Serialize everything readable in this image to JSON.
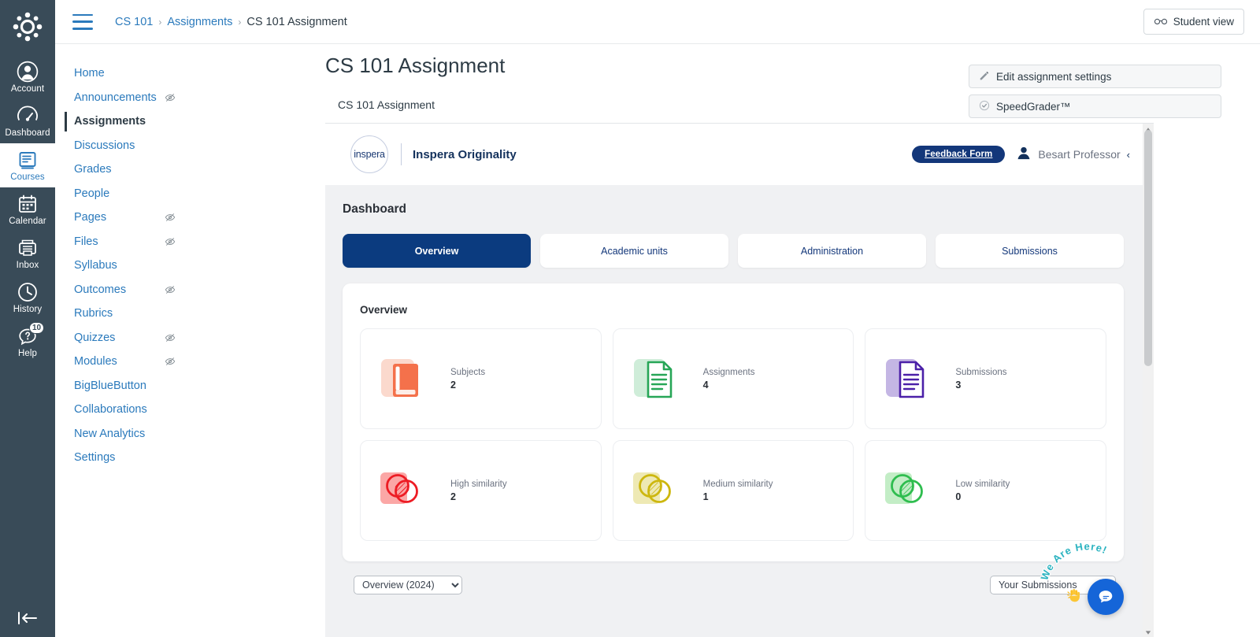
{
  "global_nav": {
    "logo_icon": "canvas-logo-icon",
    "items": [
      {
        "label": "Account",
        "icon": "account-avatar-icon",
        "active": false,
        "badge": ""
      },
      {
        "label": "Dashboard",
        "icon": "dashboard-speedometer-icon",
        "active": false,
        "badge": ""
      },
      {
        "label": "Courses",
        "icon": "courses-book-icon",
        "active": true,
        "badge": ""
      },
      {
        "label": "Calendar",
        "icon": "calendar-icon",
        "active": false,
        "badge": ""
      },
      {
        "label": "Inbox",
        "icon": "inbox-tray-icon",
        "active": false,
        "badge": ""
      },
      {
        "label": "History",
        "icon": "history-clock-icon",
        "active": false,
        "badge": ""
      },
      {
        "label": "Help",
        "icon": "help-question-bubble-icon",
        "active": false,
        "badge": "10"
      }
    ],
    "collapse_icon": "collapse-sidebar-icon"
  },
  "topbar": {
    "menu_icon": "hamburger-menu-icon",
    "breadcrumb": [
      {
        "label": "CS 101",
        "current": false
      },
      {
        "label": "Assignments",
        "current": false
      },
      {
        "label": "CS 101 Assignment",
        "current": true
      }
    ],
    "breadcrumb_separator": "›",
    "student_view_label": "Student view",
    "student_view_icon": "eyeglasses-icon"
  },
  "course_nav": {
    "items": [
      {
        "label": "Home",
        "hidden_icon": false,
        "active": false
      },
      {
        "label": "Announcements",
        "hidden_icon": true,
        "active": false
      },
      {
        "label": "Assignments",
        "hidden_icon": false,
        "active": true
      },
      {
        "label": "Discussions",
        "hidden_icon": false,
        "active": false
      },
      {
        "label": "Grades",
        "hidden_icon": false,
        "active": false
      },
      {
        "label": "People",
        "hidden_icon": false,
        "active": false
      },
      {
        "label": "Pages",
        "hidden_icon": true,
        "active": false
      },
      {
        "label": "Files",
        "hidden_icon": true,
        "active": false
      },
      {
        "label": "Syllabus",
        "hidden_icon": false,
        "active": false
      },
      {
        "label": "Outcomes",
        "hidden_icon": true,
        "active": false
      },
      {
        "label": "Rubrics",
        "hidden_icon": false,
        "active": false
      },
      {
        "label": "Quizzes",
        "hidden_icon": true,
        "active": false
      },
      {
        "label": "Modules",
        "hidden_icon": true,
        "active": false
      },
      {
        "label": "BigBlueButton",
        "hidden_icon": false,
        "active": false
      },
      {
        "label": "Collaborations",
        "hidden_icon": false,
        "active": false
      },
      {
        "label": "New Analytics",
        "hidden_icon": false,
        "active": false
      },
      {
        "label": "Settings",
        "hidden_icon": false,
        "active": false
      }
    ]
  },
  "page": {
    "title": "CS 101 Assignment",
    "description": "CS 101 Assignment"
  },
  "rail": {
    "buttons": [
      {
        "label": "Edit assignment settings",
        "icon": "pencil-icon"
      },
      {
        "label": "SpeedGrader™",
        "icon": "check-circle-icon"
      }
    ]
  },
  "inspera": {
    "logo_text": "inspera",
    "product_title": "Inspera Originality",
    "feedback_label": "Feedback Form",
    "user_name": "Besart Professor",
    "user_icon": "person-icon",
    "user_chevron": "‹",
    "dashboard_heading": "Dashboard",
    "tabs": [
      {
        "label": "Overview",
        "active": true
      },
      {
        "label": "Academic units",
        "active": false
      },
      {
        "label": "Administration",
        "active": false
      },
      {
        "label": "Submissions",
        "active": false
      }
    ],
    "overview_title": "Overview",
    "stats": [
      {
        "label": "Subjects",
        "value": "2",
        "icon": "book-icon",
        "color": "#F4714B",
        "bg": "#FBD9CD"
      },
      {
        "label": "Assignments",
        "value": "4",
        "icon": "document-icon",
        "color": "#27A657",
        "bg": "#CFEDD9"
      },
      {
        "label": "Submissions",
        "value": "3",
        "icon": "document-icon",
        "color": "#4B20A8",
        "bg": "#C4B6E4"
      },
      {
        "label": "High similarity",
        "value": "2",
        "icon": "venn-icon",
        "color": "#ED1C24",
        "bg": "#FBA7A6"
      },
      {
        "label": "Medium similarity",
        "value": "1",
        "icon": "venn-icon",
        "color": "#CDB70F",
        "bg": "#EEE9B4"
      },
      {
        "label": "Low similarity",
        "value": "0",
        "icon": "venn-icon",
        "color": "#2FBD4F",
        "bg": "#C3EDC6"
      }
    ],
    "filters": {
      "period_selected": "Overview (2024)",
      "period_options": [
        "Overview (2024)"
      ],
      "scope_selected": "Your Submissions",
      "scope_options": [
        "Your Submissions"
      ]
    },
    "scrollbar": {
      "up_arrow": "▲",
      "down_arrow": "▼"
    }
  },
  "chat": {
    "arc_text": "We Are Here!",
    "wave_icon": "waving-hand-icon",
    "button_icon": "chat-bubble-icon",
    "arc_color": "#2BB3C0"
  }
}
